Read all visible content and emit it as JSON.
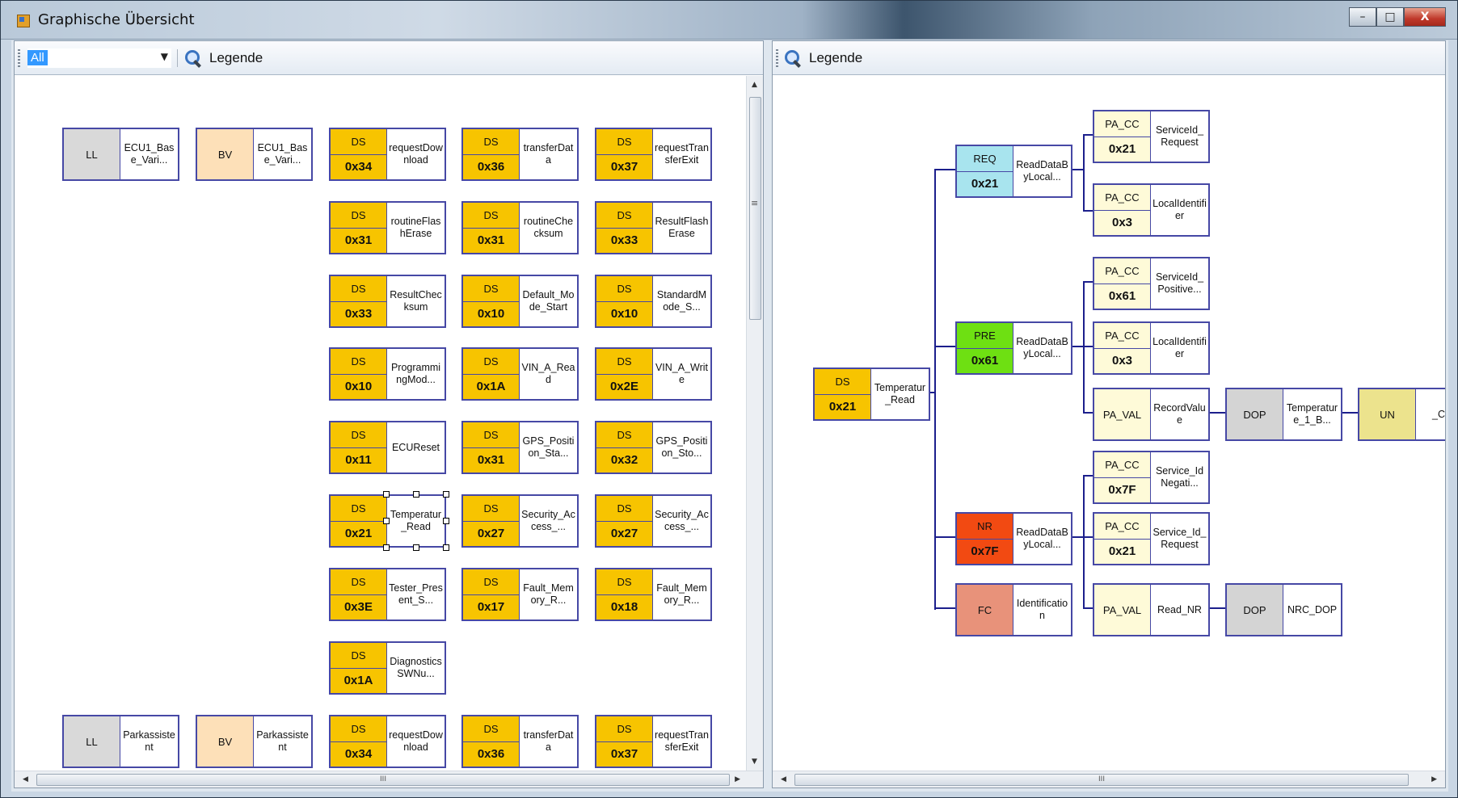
{
  "window": {
    "title": "Graphische Übersicht",
    "minimize": "–",
    "maximize": "□",
    "close": "X"
  },
  "left_pane": {
    "filter_value": "All",
    "legend_label": "Legende",
    "nodes": [
      {
        "type": "LL",
        "code": "",
        "name": "ECU1_Base_Vari..."
      },
      {
        "type": "BV",
        "code": "",
        "name": "ECU1_Base_Vari..."
      },
      {
        "type": "DS",
        "code": "0x34",
        "name": "requestDownload"
      },
      {
        "type": "DS",
        "code": "0x36",
        "name": "transferData"
      },
      {
        "type": "DS",
        "code": "0x37",
        "name": "requestTransferExit"
      },
      {
        "type": "DS",
        "code": "0x31",
        "name": "routineFlashErase"
      },
      {
        "type": "DS",
        "code": "0x31",
        "name": "routineChecksum"
      },
      {
        "type": "DS",
        "code": "0x33",
        "name": "ResultFlashErase"
      },
      {
        "type": "DS",
        "code": "0x33",
        "name": "ResultChecksum"
      },
      {
        "type": "DS",
        "code": "0x10",
        "name": "Default_Mode_Start"
      },
      {
        "type": "DS",
        "code": "0x10",
        "name": "StandardMode_S..."
      },
      {
        "type": "DS",
        "code": "0x10",
        "name": "ProgrammingMod..."
      },
      {
        "type": "DS",
        "code": "0x1A",
        "name": "VIN_A_Read"
      },
      {
        "type": "DS",
        "code": "0x2E",
        "name": "VIN_A_Write"
      },
      {
        "type": "DS",
        "code": "0x11",
        "name": "ECUReset"
      },
      {
        "type": "DS",
        "code": "0x31",
        "name": "GPS_Position_Sta..."
      },
      {
        "type": "DS",
        "code": "0x32",
        "name": "GPS_Position_Sto..."
      },
      {
        "type": "DS",
        "code": "0x21",
        "name": "Temperatur_Read"
      },
      {
        "type": "DS",
        "code": "0x27",
        "name": "Security_Access_..."
      },
      {
        "type": "DS",
        "code": "0x27",
        "name": "Security_Access_..."
      },
      {
        "type": "DS",
        "code": "0x3E",
        "name": "Tester_Present_S..."
      },
      {
        "type": "DS",
        "code": "0x17",
        "name": "Fault_Memory_R..."
      },
      {
        "type": "DS",
        "code": "0x18",
        "name": "Fault_Memory_R..."
      },
      {
        "type": "DS",
        "code": "0x1A",
        "name": "DiagnosticsSWNu..."
      },
      {
        "type": "LL",
        "code": "",
        "name": "Parkassistent"
      },
      {
        "type": "BV",
        "code": "",
        "name": "Parkassistent"
      },
      {
        "type": "DS",
        "code": "0x34",
        "name": "requestDownload"
      },
      {
        "type": "DS",
        "code": "0x36",
        "name": "transferData"
      },
      {
        "type": "DS",
        "code": "0x37",
        "name": "requestTransferExit"
      }
    ],
    "hscroll_grip": "III",
    "vscroll_grip": "≡"
  },
  "right_pane": {
    "legend_label": "Legende",
    "nodes": [
      {
        "type": "DS",
        "code": "0x21",
        "name": "Temperatur_Read"
      },
      {
        "type": "REQ",
        "code": "0x21",
        "name": "ReadDataByLocal..."
      },
      {
        "type": "PRE",
        "code": "0x61",
        "name": "ReadDataByLocal..."
      },
      {
        "type": "NR",
        "code": "0x7F",
        "name": "ReadDataByLocal..."
      },
      {
        "type": "FC",
        "code": "",
        "name": "Identification"
      },
      {
        "type": "PA_CC",
        "code": "0x21",
        "name": "ServiceId_Request"
      },
      {
        "type": "PA_CC",
        "code": "0x3",
        "name": "LocalIdentifier"
      },
      {
        "type": "PA_CC",
        "code": "0x61",
        "name": "ServiceId_Positive..."
      },
      {
        "type": "PA_CC",
        "code": "0x3",
        "name": "LocalIdentifier"
      },
      {
        "type": "PA_VAL",
        "code": "",
        "name": "RecordValue"
      },
      {
        "type": "DOP",
        "code": "",
        "name": "Temperature_1_B..."
      },
      {
        "type": "UN",
        "code": "",
        "name": "_C"
      },
      {
        "type": "PA_CC",
        "code": "0x7F",
        "name": "Service_IdNegati..."
      },
      {
        "type": "PA_CC",
        "code": "0x21",
        "name": "Service_Id_Request"
      },
      {
        "type": "PA_VAL",
        "code": "",
        "name": "Read_NR"
      },
      {
        "type": "DOP",
        "code": "",
        "name": "NRC_DOP"
      }
    ],
    "hscroll_grip": "III"
  },
  "colors": {
    "DS": "#f7c400",
    "LL": "#d9d9d9",
    "BV": "#fde0b8",
    "REQ": "#a8e4ee",
    "PRE": "#6ee012",
    "NR": "#f24a12",
    "FC": "#e8927a",
    "PA_CC": "#fefad8",
    "PA_VAL": "#fefad8",
    "DOP": "#d4d4d4",
    "UN": "#ece38d",
    "border": "#4648a5"
  }
}
